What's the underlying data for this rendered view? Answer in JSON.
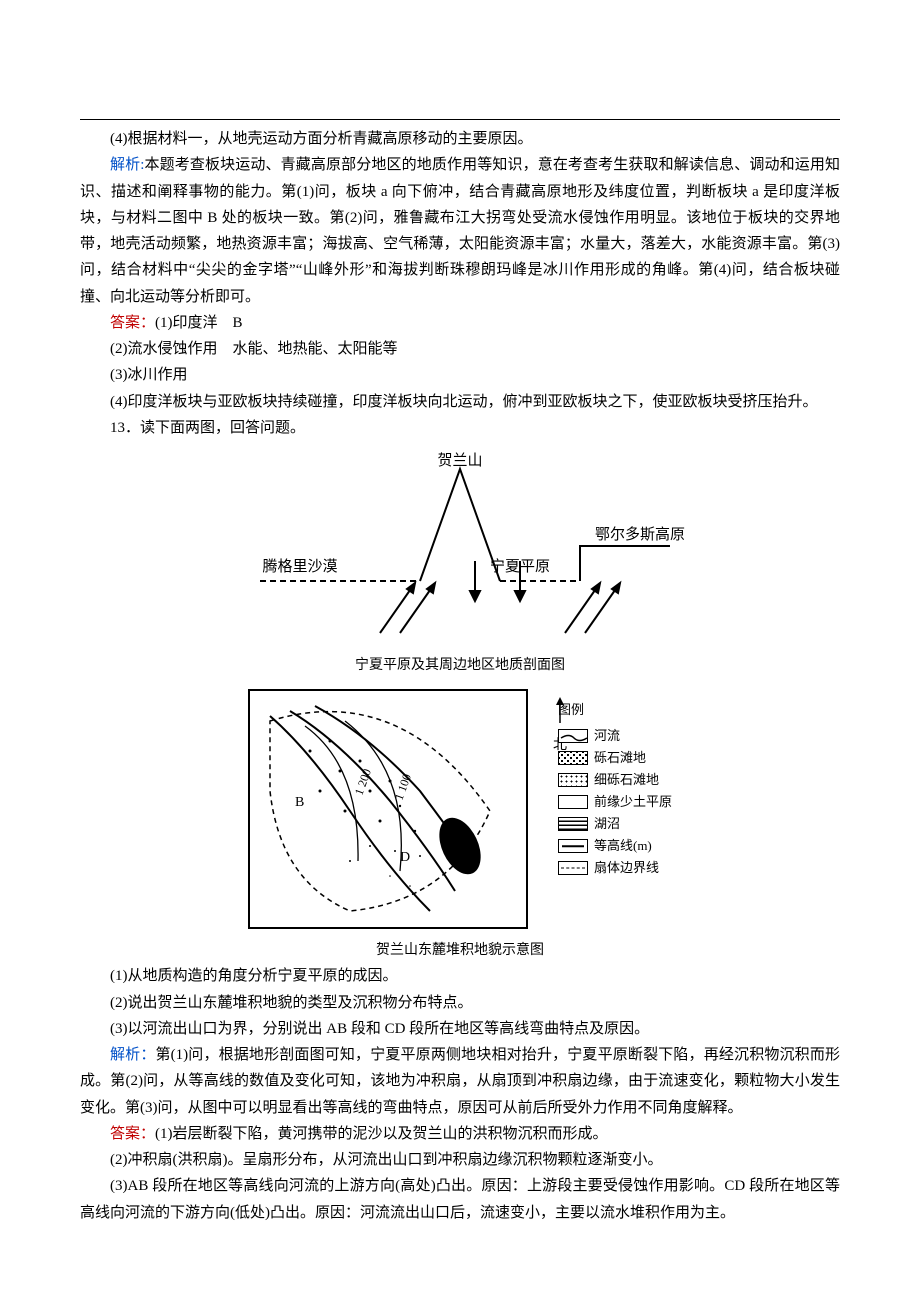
{
  "top": {
    "q4_continued": "(4)根据材料一，从地壳运动方面分析青藏高原移动的主要原因。",
    "analysis_label": "解析:",
    "analysis_body": "本题考查板块运动、青藏高原部分地区的地质作用等知识，意在考查考生获取和解读信息、调动和运用知识、描述和阐释事物的能力。第(1)问，板块 a 向下俯冲，结合青藏高原地形及纬度位置，判断板块 a 是印度洋板块，与材料二图中 B 处的板块一致。第(2)问，雅鲁藏布江大拐弯处受流水侵蚀作用明显。该地位于板块的交界地带，地壳活动频繁，地热资源丰富；海拔高、空气稀薄，太阳能资源丰富；水量大，落差大，水能资源丰富。第(3)问，结合材料中“尖尖的金字塔”“山峰外形”和海拔判断珠穆朗玛峰是冰川作用形成的角峰。第(4)问，结合板块碰撞、向北运动等分析即可。",
    "answer_label": "答案：",
    "a1": "(1)印度洋　B",
    "a2": "(2)流水侵蚀作用　水能、地热能、太阳能等",
    "a3": "(3)冰川作用",
    "a4": "(4)印度洋板块与亚欧板块持续碰撞，印度洋板块向北运动，俯冲到亚欧板块之下，使亚欧板块受挤压抬升。"
  },
  "q13": {
    "prompt": "13．读下面两图，回答问题。",
    "profile": {
      "mountain": "贺兰山",
      "left": "腾格里沙漠",
      "center": "宁夏平原",
      "right": "鄂尔多斯高原",
      "caption": "宁夏平原及其周边地区地质剖面图"
    },
    "map": {
      "north": "北",
      "contour1": "1 200",
      "contour2": "1 100",
      "pointB": "B",
      "pointD": "D",
      "caption": "贺兰山东麓堆积地貌示意图"
    },
    "legend": {
      "title": "图例",
      "river": "河流",
      "gravel": "砾石滩地",
      "fine": "细砾石滩地",
      "plain": "前缘少土平原",
      "marsh": "湖沼",
      "contour": "等高线(m)",
      "boundary": "扇体边界线"
    },
    "sub1": "(1)从地质构造的角度分析宁夏平原的成因。",
    "sub2": "(2)说出贺兰山东麓堆积地貌的类型及沉积物分布特点。",
    "sub3": "(3)以河流出山口为界，分别说出 AB 段和 CD 段所在地区等高线弯曲特点及原因。",
    "analysis_label": "解析：",
    "analysis_body": "第(1)问，根据地形剖面图可知，宁夏平原两侧地块相对抬升，宁夏平原断裂下陷，再经沉积物沉积而形成。第(2)问，从等高线的数值及变化可知，该地为冲积扇，从扇顶到冲积扇边缘，由于流速变化，颗粒物大小发生变化。第(3)问，从图中可以明显看出等高线的弯曲特点，原因可从前后所受外力作用不同角度解释。",
    "answer_label": "答案：",
    "ans1": "(1)岩层断裂下陷，黄河携带的泥沙以及贺兰山的洪积物沉积而形成。",
    "ans2": "(2)冲积扇(洪积扇)。呈扇形分布，从河流出山口到冲积扇边缘沉积物颗粒逐渐变小。",
    "ans3": "(3)AB 段所在地区等高线向河流的上游方向(高处)凸出。原因：上游段主要受侵蚀作用影响。CD 段所在地区等高线向河流的下游方向(低处)凸出。原因：河流流出山口后，流速变小，主要以流水堆积作用为主。"
  }
}
